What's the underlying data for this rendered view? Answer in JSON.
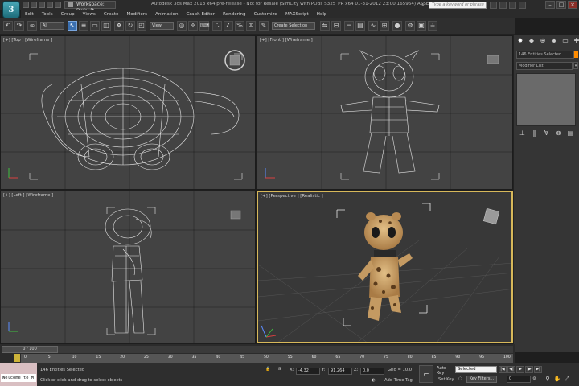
{
  "app": {
    "logo_letter": "3",
    "workspace": "Workspace: Default",
    "window_title": "Autodesk 3ds Max 2013 x64 pre-release - Not for Resale (SimCity with POBs S325_PR x64 01-31-2012 23:00 165964) ASSERTs ON   Untitled",
    "search_placeholder": "Type a keyword or phrase"
  },
  "menu": [
    "Edit",
    "Tools",
    "Group",
    "Views",
    "Create",
    "Modifiers",
    "Animation",
    "Graph Editor",
    "Rendering",
    "Customize",
    "MAXScript",
    "Help"
  ],
  "toolbar": {
    "filter": "All",
    "coord_system": "View",
    "selection_set": "Create Selection",
    "icons": [
      "undo-icon",
      "redo-icon",
      "link-icon",
      "unlink-icon",
      "bind-spacewarp-icon",
      "select-object-icon",
      "select-by-name-icon",
      "rect-selection-icon",
      "window-crossing-icon",
      "move-icon",
      "rotate-icon",
      "scale-icon",
      "pivot-icon",
      "select-manipulate-icon",
      "keyboard-shortcut-icon",
      "snaps-icon",
      "angle-snap-icon",
      "percent-snap-icon",
      "spinner-snap-icon",
      "edit-named-selection-icon",
      "mirror-icon",
      "align-icon",
      "layer-manager-icon",
      "graphite-icon",
      "curve-editor-icon",
      "schematic-view-icon",
      "material-editor-icon",
      "render-setup-icon",
      "rendered-frame-icon",
      "render-icon"
    ]
  },
  "viewports": {
    "top": "[+] [Top ] [Wireframe ]",
    "front": "[+] [Front ] [Wireframe ]",
    "left": "[+] [Left ] [Wireframe ]",
    "perspective": "[+] [Perspective ] [Realistic ]"
  },
  "command_panel": {
    "tabs": [
      "create-tab-icon",
      "modify-tab-icon",
      "hierarchy-tab-icon",
      "motion-tab-icon",
      "display-tab-icon",
      "utilities-tab-icon"
    ],
    "selection_field": "146 Entities Selected",
    "modifier_list": "Modifier List",
    "stack_icons": [
      "pin-stack-icon",
      "show-end-result-icon",
      "make-unique-icon",
      "remove-modifier-icon",
      "configure-sets-icon"
    ],
    "swatch_color": "#ff8c00"
  },
  "timeline": {
    "slider": "0 / 100",
    "ticks": [
      "0",
      "5",
      "10",
      "15",
      "20",
      "25",
      "30",
      "35",
      "40",
      "45",
      "50",
      "55",
      "60",
      "65",
      "70",
      "75",
      "80",
      "85",
      "90",
      "95",
      "100"
    ]
  },
  "status": {
    "welcome": "Welcome to M",
    "entities": "146 Entities Selected",
    "prompt": "Click or click-and-drag to select objects",
    "x_label": "X:",
    "x_value": "-4.32",
    "y_label": "Y:",
    "y_value": "91.264",
    "z_label": "Z:",
    "z_value": "0.0",
    "grid": "Grid = 10.0",
    "add_time_tag": "Add Time Tag",
    "auto_key": "Auto Key",
    "set_key": "Set Key",
    "selected": "Selected",
    "key_filters": "Key Filters...",
    "frame": "0"
  }
}
